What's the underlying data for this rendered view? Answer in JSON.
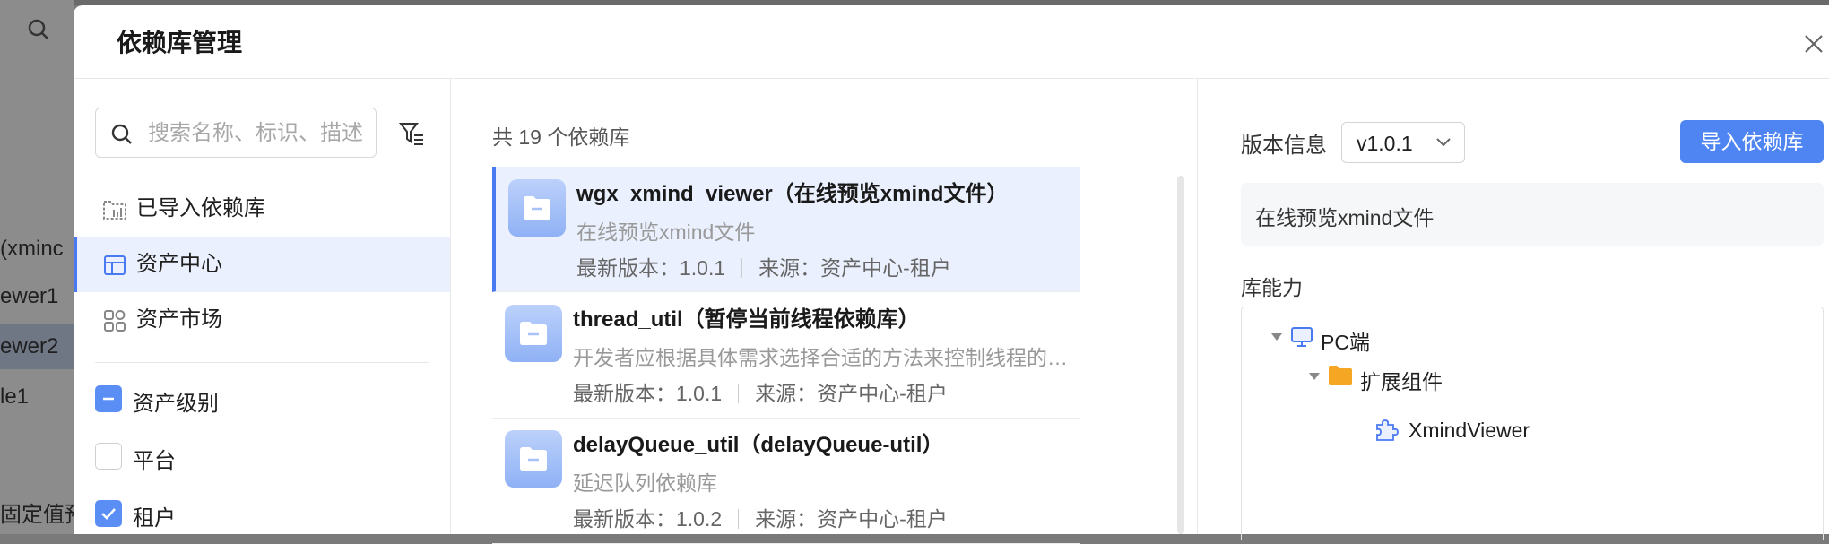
{
  "background": {
    "rows": [
      "(xminc",
      "ewer1",
      "ewer2",
      "le1",
      "固定值预"
    ]
  },
  "modal": {
    "title": "依赖库管理"
  },
  "left": {
    "search_placeholder": "搜索名称、标识、描述",
    "nav": [
      {
        "label": "已导入依赖库",
        "icon": "imported-library-icon"
      },
      {
        "label": "资产中心",
        "icon": "asset-center-icon"
      },
      {
        "label": "资产市场",
        "icon": "asset-market-icon"
      }
    ],
    "filters": [
      {
        "label": "资产级别",
        "state": "indeterminate"
      },
      {
        "label": "平台",
        "state": "unchecked"
      },
      {
        "label": "租户",
        "state": "checked"
      }
    ]
  },
  "middle": {
    "count_text": "共 19 个依赖库",
    "items": [
      {
        "title": "wgx_xmind_viewer（在线预览xmind文件）",
        "desc": "在线预览xmind文件",
        "version": "最新版本：1.0.1",
        "source": "来源：资产中心-租户"
      },
      {
        "title": "thread_util（暂停当前线程依赖库）",
        "desc": "开发者应根据具体需求选择合适的方法来控制线程的暂停和恢复",
        "version": "最新版本：1.0.1",
        "source": "来源：资产中心-租户"
      },
      {
        "title": "delayQueue_util（delayQueue-util）",
        "desc": "延迟队列依赖库",
        "version": "最新版本：1.0.2",
        "source": "来源：资产中心-租户"
      }
    ]
  },
  "right": {
    "version_label": "版本信息",
    "version_value": "v1.0.1",
    "import_button": "导入依赖库",
    "description": "在线预览xmind文件",
    "capability_label": "库能力",
    "tree": {
      "platform": "PC端",
      "folder": "扩展组件",
      "component": "XmindViewer"
    }
  },
  "colors": {
    "accent": "#4f85f3",
    "selected_bg": "#eaf0fd",
    "folder_icon": "#f5a623"
  }
}
